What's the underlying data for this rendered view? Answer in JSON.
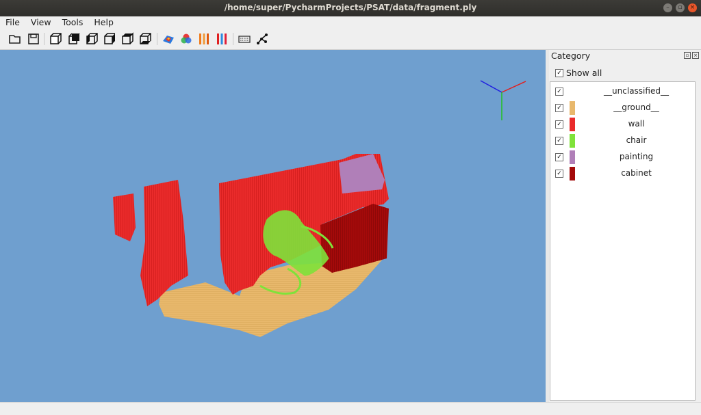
{
  "window": {
    "title": "/home/super/PycharmProjects/PSAT/data/fragment.ply"
  },
  "menu": [
    "File",
    "View",
    "Tools",
    "Help"
  ],
  "toolbar": {
    "icons": [
      "open-folder-icon",
      "save-icon",
      "view-front-icon",
      "view-back-icon",
      "view-left-icon",
      "view-right-icon",
      "view-top-icon",
      "view-bottom-icon",
      "color-by-elevation-icon",
      "color-by-rgb-icon",
      "color-by-category-icon",
      "color-by-instance-icon",
      "keyboard-icon",
      "graph-nodes-icon"
    ]
  },
  "panel": {
    "title": "Category",
    "show_all_label": "Show all",
    "show_all_checked": true,
    "categories": [
      {
        "label": "__unclassified__",
        "checked": true,
        "color": ""
      },
      {
        "label": "__ground__",
        "checked": true,
        "color": "#e8b86c"
      },
      {
        "label": "wall",
        "checked": true,
        "color": "#ea2b2b"
      },
      {
        "label": "chair",
        "checked": true,
        "color": "#7fe23a"
      },
      {
        "label": "painting",
        "checked": true,
        "color": "#b07fb8"
      },
      {
        "label": "cabinet",
        "checked": true,
        "color": "#a40a0a"
      }
    ]
  },
  "viewport": {
    "background": "#6f9fcf",
    "axis_colors": {
      "x": "#e02020",
      "y": "#20c020",
      "z": "#2020e0"
    }
  }
}
